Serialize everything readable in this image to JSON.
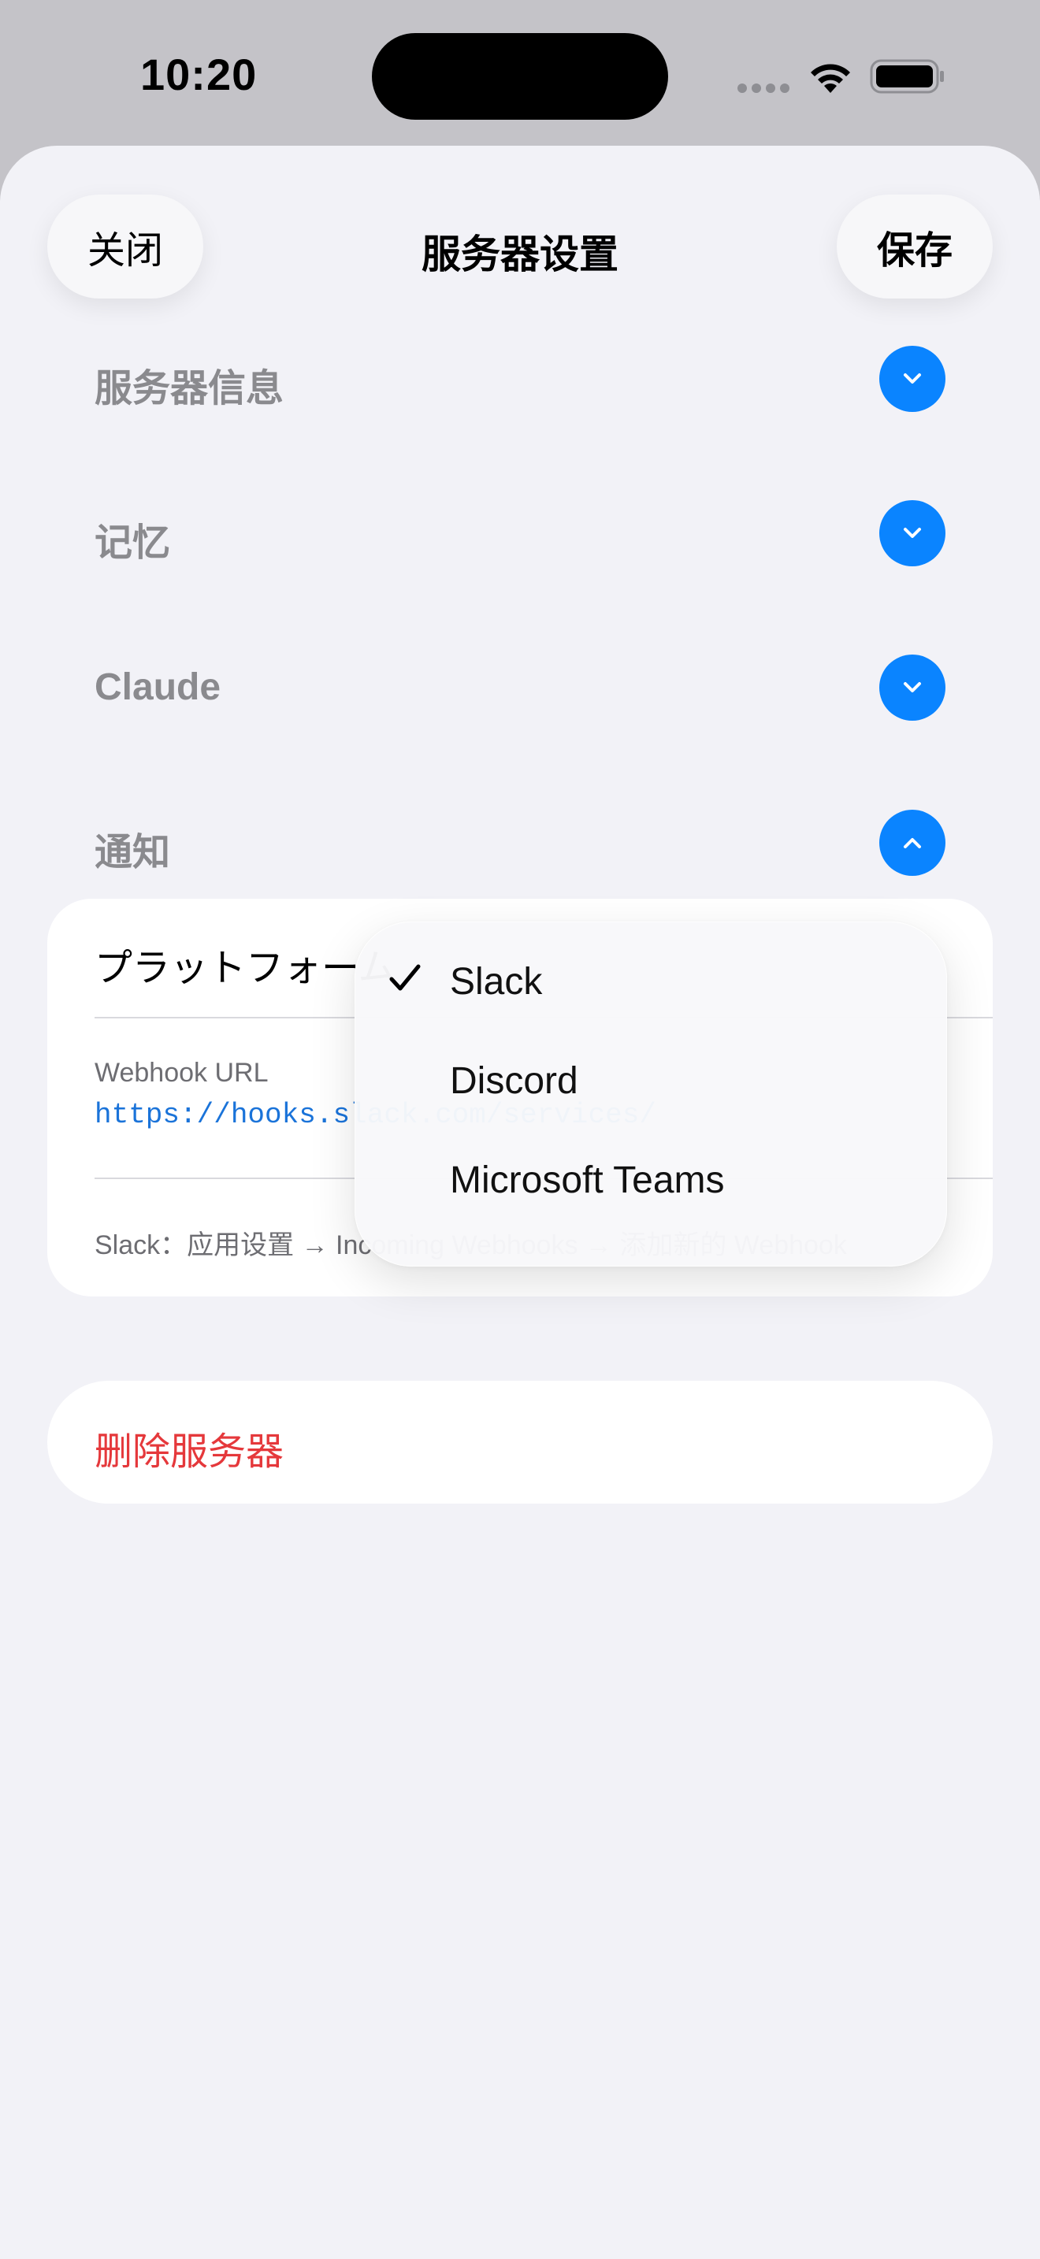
{
  "status_bar": {
    "time": "10:20"
  },
  "nav": {
    "close_label": "关闭",
    "title": "服务器设置",
    "save_label": "保存"
  },
  "sections": [
    {
      "label": "服务器信息",
      "expanded": false
    },
    {
      "label": "记忆",
      "expanded": false
    },
    {
      "label": "Claude",
      "expanded": false
    },
    {
      "label": "通知",
      "expanded": true
    }
  ],
  "notifications": {
    "platform_label": "プラットフォーム",
    "webhook_label": "Webhook URL",
    "webhook_value": "https://hooks.slack.com/services/",
    "help_text": "Slack：应用设置 → Incoming Webhooks → 添加新的 Webhook"
  },
  "platform_dropdown": {
    "options": [
      {
        "label": "Slack",
        "selected": true
      },
      {
        "label": "Discord",
        "selected": false
      },
      {
        "label": "Microsoft Teams",
        "selected": false
      }
    ]
  },
  "delete_label": "删除服务器",
  "colors": {
    "accent": "#0a84ff",
    "destructive": "#e5383b",
    "link": "#1a73d9"
  },
  "icons": {
    "chevron_collapsed": "chevron-down-icon",
    "chevron_expanded": "chevron-up-icon",
    "checkmark": "checkmark-icon"
  }
}
